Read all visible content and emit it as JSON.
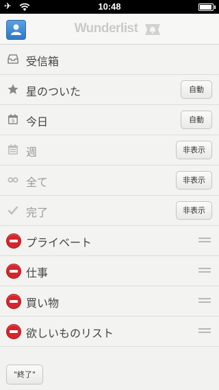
{
  "status_bar": {
    "time": "10:48"
  },
  "nav": {
    "title": "Wunderlist"
  },
  "smart_lists": [
    {
      "id": "inbox",
      "label": "受信箱",
      "icon": "inbox-icon",
      "dim": false,
      "button": ""
    },
    {
      "id": "starred",
      "label": "星のついた",
      "icon": "star-icon",
      "dim": false,
      "button": "自動"
    },
    {
      "id": "today",
      "label": "今日",
      "icon": "calendar-today-icon",
      "dim": false,
      "button": "自動"
    },
    {
      "id": "week",
      "label": "週",
      "icon": "calendar-week-icon",
      "dim": true,
      "button": "非表示"
    },
    {
      "id": "all",
      "label": "全て",
      "icon": "infinity-icon",
      "dim": true,
      "button": "非表示"
    },
    {
      "id": "done",
      "label": "完了",
      "icon": "checkmark-icon",
      "dim": true,
      "button": "非表示"
    }
  ],
  "user_lists": [
    {
      "label": "プライベート"
    },
    {
      "label": "仕事"
    },
    {
      "label": "買い物"
    },
    {
      "label": "欲しいものリスト"
    }
  ],
  "footer": {
    "finish_label": "\"終了\""
  },
  "colors": {
    "delete_red": "#d8242a",
    "avatar_blue": "#3a86d4"
  }
}
